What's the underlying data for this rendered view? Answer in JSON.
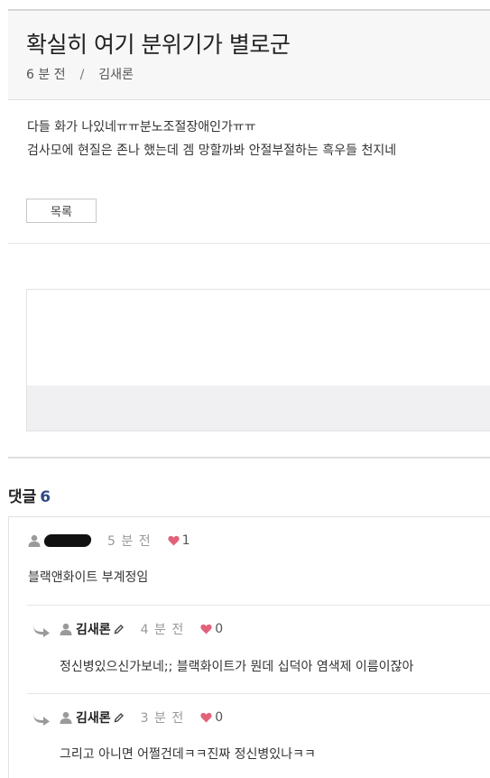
{
  "post": {
    "title": "확실히 여기 분위기가 별로군",
    "time": "6 분 전",
    "separator": "/",
    "author": "김새론",
    "body_lines": [
      "다들 화가 나있네ㅠㅠ분노조절장애인가ㅠㅠ",
      "검사모에 현질은 존나 했는데 겜 망할까봐 안절부절하는 흑우들 천지네"
    ],
    "list_button_label": "목록"
  },
  "comments_section": {
    "heading": "댓글",
    "count": "6"
  },
  "comments": [
    {
      "author": "",
      "author_redacted": true,
      "time": "5 분 전",
      "likes": "1",
      "body": "블랙앤화이트 부계정임"
    },
    {
      "author": "김새론",
      "is_reply": true,
      "time": "4 분 전",
      "likes": "0",
      "body": "정신병있으신가보네;; 블랙화이트가 뭔데 십덕아 염색제 이름이잖아"
    },
    {
      "author": "김새론",
      "is_reply": true,
      "time": "3 분 전",
      "likes": "0",
      "body": "그리고 아니면 어쩔건데ㅋㅋ진짜 정신병있나ㅋㅋ"
    }
  ],
  "colors": {
    "heart": "#e2627a",
    "count_accent": "#2f4a85",
    "icon_gray": "#9a9a9a"
  },
  "icons": [
    "user-icon",
    "pencil-icon",
    "heart-icon",
    "reply-arrow-icon"
  ]
}
